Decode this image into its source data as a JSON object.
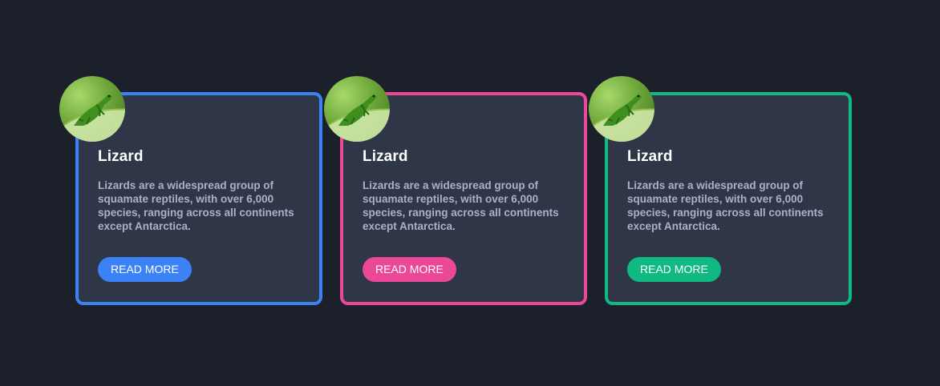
{
  "cards": [
    {
      "title": "Lizard",
      "text": "Lizards are a widespread group of squamate reptiles, with over 6,000 species, ranging across all continents except Antarctica.",
      "button_label": "READ MORE",
      "accent": "#3b82f6"
    },
    {
      "title": "Lizard",
      "text": "Lizards are a widespread group of squamate reptiles, with over 6,000 species, ranging across all continents except Antarctica.",
      "button_label": "READ MORE",
      "accent": "#ec4899"
    },
    {
      "title": "Lizard",
      "text": "Lizards are a widespread group of squamate reptiles, with over 6,000 species, ranging across all continents except Antarctica.",
      "button_label": "READ MORE",
      "accent": "#10b981"
    }
  ],
  "colors": {
    "background": "#1b202b",
    "card_background": "#2e3647",
    "title_text": "#ffffff",
    "body_text": "#a9b3c6"
  },
  "image_icon": "lizard-photo"
}
